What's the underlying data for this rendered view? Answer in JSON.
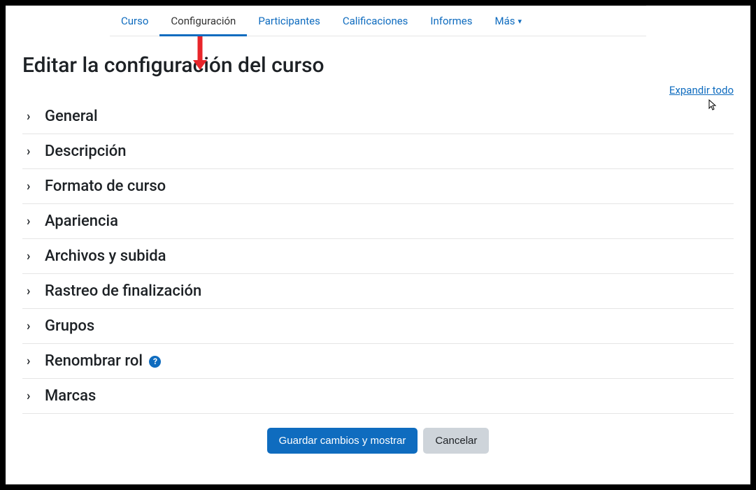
{
  "nav": {
    "tabs": [
      {
        "label": "Curso"
      },
      {
        "label": "Configuración",
        "active": true
      },
      {
        "label": "Participantes"
      },
      {
        "label": "Calificaciones"
      },
      {
        "label": "Informes"
      },
      {
        "label": "Más",
        "dropdown": true
      }
    ]
  },
  "page": {
    "title": "Editar la configuración del curso",
    "expand_all": "Expandir todo"
  },
  "sections": [
    {
      "label": "General"
    },
    {
      "label": "Descripción"
    },
    {
      "label": "Formato de curso"
    },
    {
      "label": "Apariencia"
    },
    {
      "label": "Archivos y subida"
    },
    {
      "label": "Rastreo de finalización"
    },
    {
      "label": "Grupos"
    },
    {
      "label": "Renombrar rol",
      "help": true
    },
    {
      "label": "Marcas"
    }
  ],
  "buttons": {
    "save": "Guardar cambios y mostrar",
    "cancel": "Cancelar"
  }
}
